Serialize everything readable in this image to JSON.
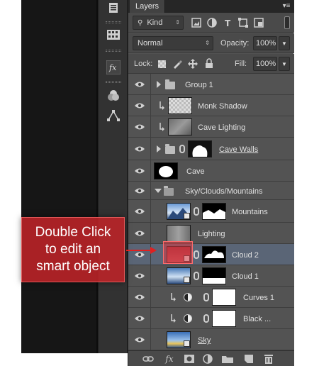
{
  "panel": {
    "tab_label": "Layers",
    "menu_icon": "panel-menu-icon",
    "filter": {
      "kind_label": "Kind"
    },
    "blend_mode": "Normal",
    "opacity_label": "Opacity:",
    "opacity_value": "100%",
    "lock_label": "Lock:",
    "fill_label": "Fill:",
    "fill_value": "100%"
  },
  "layers": [
    {
      "name": "Group 1",
      "type": "group",
      "expanded": false
    },
    {
      "name": "Monk Shadow",
      "type": "pixel",
      "clipped": true
    },
    {
      "name": "Cave Lighting",
      "type": "pixel",
      "clipped": true
    },
    {
      "name": "Cave Walls",
      "type": "masked",
      "underlined": true
    },
    {
      "name": "Cave",
      "type": "pixel"
    },
    {
      "name": "Sky/Clouds/Mountains",
      "type": "group",
      "expanded": true
    },
    {
      "name": "Mountains",
      "type": "smart-masked"
    },
    {
      "name": "Lighting",
      "type": "pixel"
    },
    {
      "name": "Cloud 2",
      "type": "smart-masked",
      "selected": true
    },
    {
      "name": "Cloud 1",
      "type": "smart-masked"
    },
    {
      "name": "Curves 1",
      "type": "adjustment",
      "clipped": true
    },
    {
      "name": "Black ...",
      "type": "adjustment",
      "clipped": true
    },
    {
      "name": "Sky",
      "type": "smart",
      "underlined": true
    }
  ],
  "callout": {
    "line1": "Double Click",
    "line2": "to edit an",
    "line3": "smart object",
    "color": "#be2328"
  },
  "footer_icons": [
    "link-icon",
    "fx-icon",
    "mask-icon",
    "adjustment-icon",
    "folder-icon",
    "new-layer-icon",
    "trash-icon"
  ]
}
